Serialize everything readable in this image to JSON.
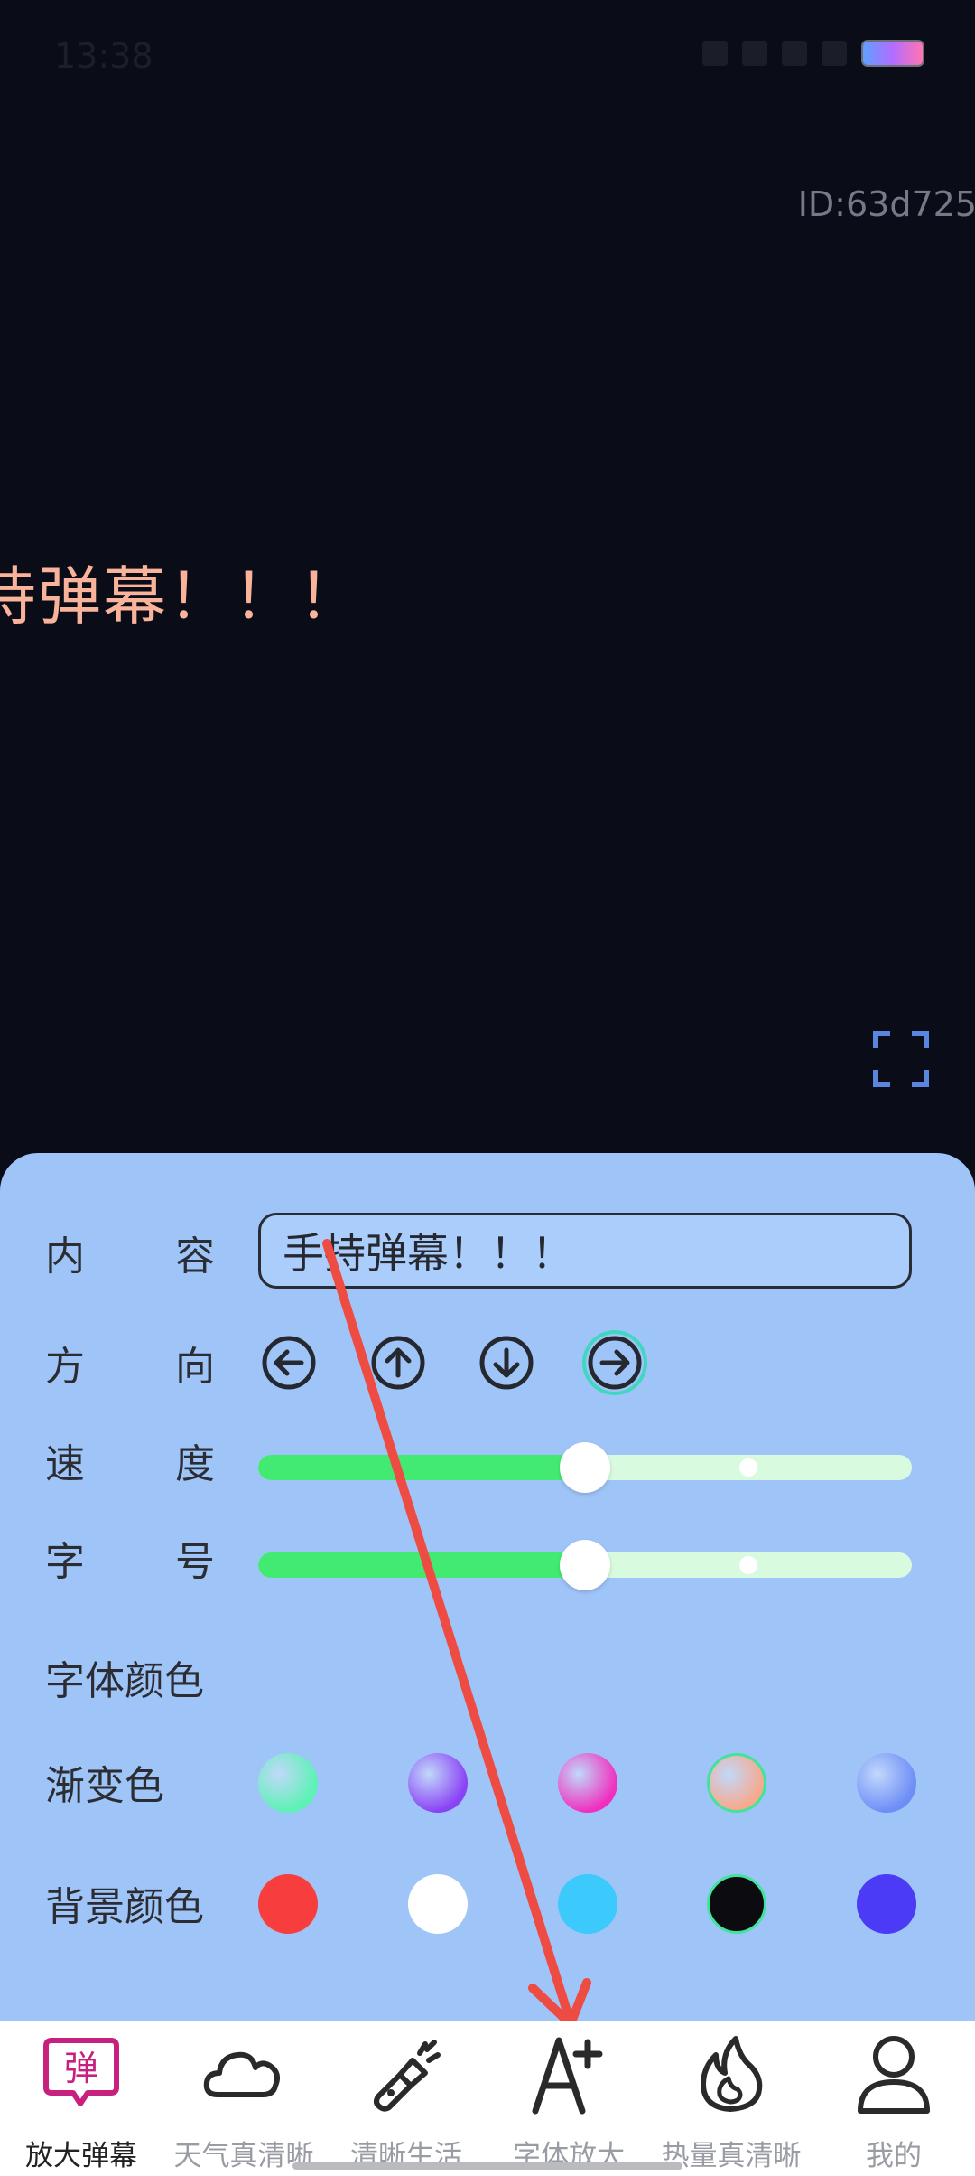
{
  "status_bar": {
    "time": "13:38"
  },
  "device_id": "ID:63d725",
  "marquee_text": "持弹幕！！！",
  "panel": {
    "content": {
      "label_a": "内",
      "label_b": "容",
      "value": "手持弹幕！！！"
    },
    "direction": {
      "label_a": "方",
      "label_b": "向",
      "options": [
        "left",
        "up",
        "down",
        "right"
      ],
      "selected": "right"
    },
    "speed": {
      "label_a": "速",
      "label_b": "度",
      "value": 0.5
    },
    "font_size": {
      "label_a": "字",
      "label_b": "号",
      "value": 0.5
    },
    "font_color": {
      "label": "字体颜色"
    },
    "gradient": {
      "label": "渐变色",
      "swatches": [
        "#5cf2b4",
        "#8a42f5",
        "#f02fbf",
        "#f7a98e",
        "#6e8df7"
      ],
      "selected_index": 3
    },
    "background": {
      "label": "背景颜色",
      "swatches": [
        "#f73d3d",
        "#ffffff",
        "#3cc9fb",
        "#0b0b10",
        "#4c3bf6"
      ],
      "selected_index": 3
    }
  },
  "colors": {
    "accent": "#c7207f",
    "panel": "#9fc4f8",
    "slider_fill": "#43ea72",
    "annotation_arrow": "#ee4b43"
  },
  "nav": {
    "items": [
      {
        "label": "放大弹幕",
        "icon": "danmu-bubble-icon"
      },
      {
        "label": "天气真清晰",
        "icon": "cloud-icon"
      },
      {
        "label": "清晰生活",
        "icon": "flashlight-icon"
      },
      {
        "label": "字体放大",
        "icon": "font-enlarge-icon"
      },
      {
        "label": "热量真清晰",
        "icon": "flame-icon"
      },
      {
        "label": "我的",
        "icon": "user-icon"
      }
    ],
    "bubble_char": "弹",
    "active_index": 0
  }
}
